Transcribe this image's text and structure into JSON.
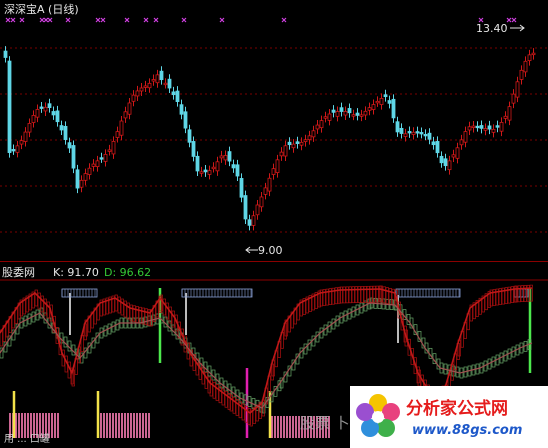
{
  "window": {
    "title": "深深宝A (日线)",
    "high_label": "13.40",
    "low_label": "9.00"
  },
  "indicator": {
    "name": "股委网",
    "k_text": "K: 91.70",
    "d_text": "D: 96.62",
    "bottom_text": "用 ... 口罐",
    "ghost_text": "股票 卜"
  },
  "watermark": {
    "name": "分析家公式网",
    "url": "www.88gs.com"
  },
  "colors": {
    "up": "#d01818",
    "down": "#5fd6e6",
    "marker": "#d040e0",
    "k_line": "#c01818",
    "d_line": "#6aa86a",
    "grid": "#7a0000"
  }
}
